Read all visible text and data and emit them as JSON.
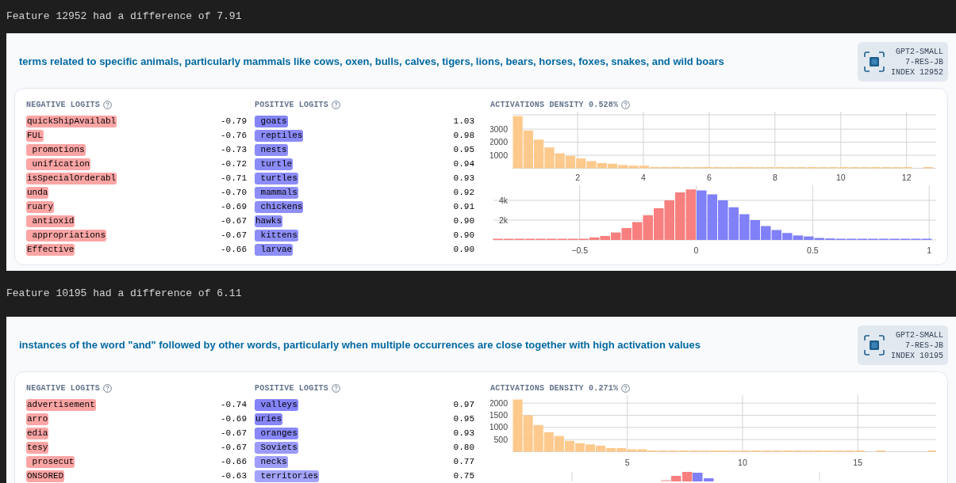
{
  "features": [
    {
      "header": "Feature 12952 had a difference of 7.91",
      "description": "terms related to specific animals, particularly mammals like cows, oxen, bulls, calves, tigers, lions, bears, horses, foxes, snakes, and wild boars",
      "badge": {
        "model": "GPT2-SMALL",
        "layer": "7-RES-JB",
        "index": "INDEX 12952"
      },
      "negative_logits": {
        "title": "NEGATIVE LOGITS",
        "items": [
          {
            "token": "quickShipAvailabl",
            "value": "-0.79",
            "color": "#fca5a5"
          },
          {
            "token": "FUL",
            "value": "-0.76",
            "color": "#fca5a5"
          },
          {
            "token": " promotions",
            "value": "-0.73",
            "color": "#fca5a5"
          },
          {
            "token": " unification",
            "value": "-0.72",
            "color": "#fca5a5"
          },
          {
            "token": "isSpecialOrderabl",
            "value": "-0.71",
            "color": "#fca5a5"
          },
          {
            "token": "unda",
            "value": "-0.70",
            "color": "#fca5a5"
          },
          {
            "token": "ruary",
            "value": "-0.69",
            "color": "#fca5a5"
          },
          {
            "token": " antioxid",
            "value": "-0.67",
            "color": "#fca5a5"
          },
          {
            "token": " appropriations",
            "value": "-0.67",
            "color": "#fca5a5"
          },
          {
            "token": "Effective",
            "value": "-0.66",
            "color": "#fca5a5"
          }
        ]
      },
      "positive_logits": {
        "title": "POSITIVE LOGITS",
        "items": [
          {
            "token": " goats",
            "value": "1.03",
            "color": "#8585f9"
          },
          {
            "token": " reptiles",
            "value": "0.98",
            "color": "#8a8af9"
          },
          {
            "token": " nests",
            "value": "0.95",
            "color": "#8c8cf9"
          },
          {
            "token": " turtle",
            "value": "0.94",
            "color": "#8c8cf9"
          },
          {
            "token": " turtles",
            "value": "0.93",
            "color": "#8d8df9"
          },
          {
            "token": " mammals",
            "value": "0.92",
            "color": "#8d8df9"
          },
          {
            "token": " chickens",
            "value": "0.91",
            "color": "#8e8ef9"
          },
          {
            "token": "hawks",
            "value": "0.90",
            "color": "#8e8ef9"
          },
          {
            "token": " kittens",
            "value": "0.90",
            "color": "#8e8ef9"
          },
          {
            "token": " larvae",
            "value": "0.90",
            "color": "#8e8ef9"
          }
        ]
      },
      "density": {
        "title": "ACTIVATIONS DENSITY 0.528%",
        "chart_data": {
          "type": "bar",
          "grid": true,
          "xlim": [
            0.02,
            12.9
          ],
          "ylim": [
            0,
            4100
          ],
          "xticks": [
            2,
            4,
            6,
            8,
            10,
            12
          ],
          "yticks": [
            1000,
            2000,
            3000
          ],
          "x": [
            0.18,
            0.5,
            0.82,
            1.14,
            1.46,
            1.78,
            2.1,
            2.42,
            2.74,
            3.06,
            3.38,
            3.7,
            4.02,
            4.34,
            4.66,
            4.98,
            5.3,
            5.62,
            5.94,
            6.26,
            6.58,
            6.9,
            7.22,
            7.54,
            7.86,
            8.18,
            8.5,
            8.82,
            9.14,
            9.46,
            9.78,
            10.1,
            10.42,
            10.74,
            11.06,
            11.38,
            11.7,
            12.02,
            12.34,
            12.66
          ],
          "series": [
            {
              "color": "#fdc98c",
              "values": [
                4000,
                2900,
                2200,
                1600,
                1150,
                950,
                750,
                550,
                400,
                350,
                250,
                200,
                200,
                100,
                100,
                100,
                50,
                50,
                100,
                50,
                50,
                50,
                50,
                50,
                50,
                50,
                50,
                50,
                50,
                50,
                50,
                50,
                50,
                50,
                50,
                50,
                50,
                50,
                null,
                50
              ]
            }
          ]
        }
      },
      "logits_histogram": {
        "kind": "chart",
        "chart_data": {
          "type": "bar",
          "grid": true,
          "xlim": [
            -0.87,
            1.03
          ],
          "ylim": [
            0,
            5200
          ],
          "xticks": [
            {
              "value": -0.5,
              "label": "−0.5"
            },
            0,
            0.5,
            1
          ],
          "yticks": [
            {
              "value": 2000,
              "label": "2k"
            },
            {
              "value": 4000,
              "label": "4k"
            }
          ],
          "x": [
            -0.851,
            -0.805,
            -0.759,
            -0.713,
            -0.667,
            -0.621,
            -0.575,
            -0.529,
            -0.483,
            -0.437,
            -0.391,
            -0.345,
            -0.299,
            -0.253,
            -0.207,
            -0.161,
            -0.115,
            -0.069,
            -0.023,
            0.023,
            0.069,
            0.115,
            0.161,
            0.207,
            0.253,
            0.299,
            0.345,
            0.391,
            0.437,
            0.483,
            0.529,
            0.575,
            0.621,
            0.667,
            0.713,
            0.759,
            0.805,
            0.851,
            0.897,
            0.943,
            0.989
          ],
          "series": [
            {
              "color": "#f87f7f",
              "values": [
                50,
                50,
                50,
                50,
                50,
                50,
                50,
                50,
                100,
                250,
                400,
                750,
                1200,
                1800,
                2500,
                3200,
                4000,
                4800,
                5100,
                null,
                null,
                null,
                null,
                null,
                null,
                null,
                null,
                null,
                null,
                null,
                null,
                null,
                null,
                null,
                null,
                null,
                null,
                null,
                null,
                null,
                null
              ]
            },
            {
              "color": "#8080f8",
              "values": [
                null,
                null,
                null,
                null,
                null,
                null,
                null,
                null,
                null,
                null,
                null,
                null,
                null,
                null,
                null,
                null,
                null,
                null,
                null,
                5000,
                4600,
                4000,
                3300,
                2600,
                2000,
                1400,
                1000,
                700,
                450,
                350,
                200,
                150,
                100,
                50,
                50,
                50,
                50,
                50,
                50,
                50,
                50
              ]
            }
          ]
        }
      }
    },
    {
      "header": "Feature 10195 had a difference of 6.11",
      "description": "instances of the word \"and\" followed by other words, particularly when multiple occurrences are close together with high activation values",
      "badge": {
        "model": "GPT2-SMALL",
        "layer": "7-RES-JB",
        "index": "INDEX 10195"
      },
      "negative_logits": {
        "title": "NEGATIVE LOGITS",
        "items": [
          {
            "token": "advertisement",
            "value": "-0.74",
            "color": "#fca5a5"
          },
          {
            "token": "arro",
            "value": "-0.69",
            "color": "#fca5a5"
          },
          {
            "token": "edia",
            "value": "-0.67",
            "color": "#fca5a5"
          },
          {
            "token": "tesy",
            "value": "-0.67",
            "color": "#fca5a5"
          },
          {
            "token": " prosecut",
            "value": "-0.66",
            "color": "#fca5a5"
          },
          {
            "token": "ONSORED",
            "value": "-0.63",
            "color": "#fca5a5"
          }
        ]
      },
      "positive_logits": {
        "title": "POSITIVE LOGITS",
        "items": [
          {
            "token": " valleys",
            "value": "0.97",
            "color": "#8484f9"
          },
          {
            "token": "uries",
            "value": "0.95",
            "color": "#8686f9"
          },
          {
            "token": " oranges",
            "value": "0.93",
            "color": "#8888f9"
          },
          {
            "token": " Soviets",
            "value": "0.80",
            "color": "#9a9af9"
          },
          {
            "token": " necks",
            "value": "0.77",
            "color": "#9e9efa"
          },
          {
            "token": " territories",
            "value": "0.75",
            "color": "#a3a3fa"
          }
        ]
      },
      "density": {
        "title": "ACTIVATIONS DENSITY 0.271%",
        "chart_data": {
          "type": "bar",
          "grid": true,
          "xlim": [
            0.02,
            18.4
          ],
          "ylim": [
            0,
            2200
          ],
          "xticks": [
            5,
            10,
            15
          ],
          "yticks": [
            500,
            1000,
            1500,
            2000
          ],
          "x": [
            0.245,
            0.695,
            1.145,
            1.595,
            2.045,
            2.495,
            2.945,
            3.395,
            3.845,
            4.295,
            4.745,
            5.195,
            5.645,
            6.095,
            6.545,
            6.995,
            7.445,
            7.895,
            8.345,
            8.795,
            9.245,
            9.695,
            10.145,
            10.595,
            11.045,
            11.495,
            11.945,
            12.395,
            12.845,
            13.295,
            13.745,
            14.195,
            14.645,
            15.095,
            15.545,
            15.995,
            16.445,
            16.895,
            17.345,
            17.795,
            18.245
          ],
          "series": [
            {
              "color": "#fdc98c",
              "values": [
                2150,
                1500,
                1100,
                800,
                650,
                450,
                350,
                300,
                250,
                150,
                150,
                100,
                100,
                50,
                50,
                50,
                50,
                50,
                50,
                50,
                50,
                50,
                50,
                50,
                50,
                50,
                50,
                50,
                50,
                50,
                50,
                50,
                50,
                50,
                null,
                50,
                null,
                null,
                null,
                null,
                50
              ]
            }
          ]
        }
      }
    }
  ]
}
